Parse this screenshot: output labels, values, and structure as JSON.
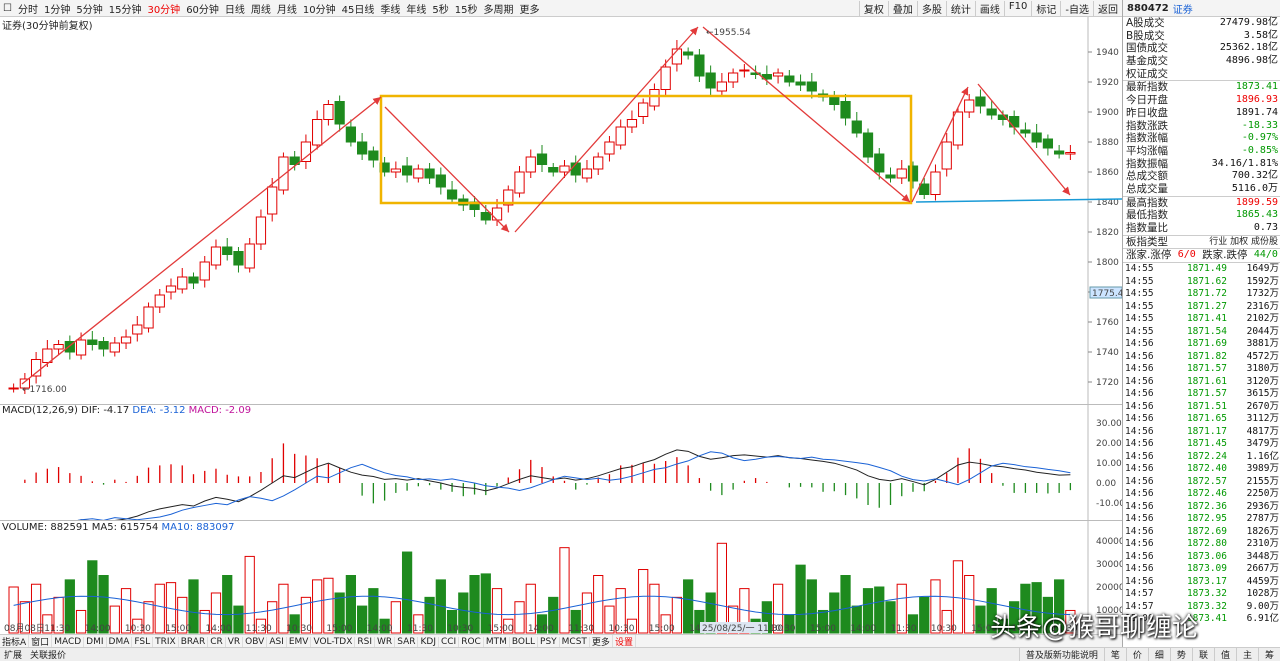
{
  "toolbar": {
    "items": [
      "分时",
      "1分钟",
      "5分钟",
      "15分钟",
      "30分钟",
      "60分钟",
      "日线",
      "周线",
      "月线",
      "10分钟",
      "45日线",
      "季线",
      "年线",
      "5秒",
      "15秒",
      "多周期",
      "更多"
    ],
    "active_index": 4,
    "right_items": [
      "复权",
      "叠加",
      "多股",
      "统计",
      "画线",
      "F10",
      "标记",
      "-自选",
      "返回"
    ]
  },
  "chart_title": "证券(30分钟前复权)",
  "price_chart": {
    "axis_ticks": [
      "1940",
      "1920",
      "1900",
      "1880",
      "1860",
      "1840",
      "1820",
      "1800",
      "1780",
      "1760",
      "1740",
      "1720"
    ],
    "current_price_tag": "1775.4",
    "high_label": "1955.54",
    "low_label": "1716.00",
    "date_labels": [
      "08月08日",
      "11:30",
      "14:00",
      "10:30",
      "15:00",
      "14:00",
      "11:30",
      "10:30",
      "15:00",
      "14:00",
      "11:30",
      "10:30",
      "15:00",
      "14:00",
      "11:30",
      "10:30",
      "15:00",
      "14:00",
      "11:30",
      "10:30",
      "15:00",
      "14:00",
      "11:30",
      "10:30",
      "15:00",
      "14:00",
      "11:30"
    ],
    "cursor_date": "25/08/25/一 11:30"
  },
  "macd": {
    "label": "MACD(12,26,9)",
    "dif": "DIF: -4.17",
    "dea": "DEA: -3.12",
    "macd": "MACD: -2.09",
    "axis_ticks": [
      "30.00",
      "20.00",
      "10.00",
      "0.00",
      "-10.00"
    ]
  },
  "volume": {
    "label": "VOLUME: 882591",
    "ma5": "MA5: 615754",
    "ma10": "MA10: 883097",
    "axis_ticks": [
      "40000",
      "30000",
      "20000",
      "10000"
    ]
  },
  "indicator_tabs": [
    "指标A",
    "窗口",
    "MACD",
    "DMI",
    "DMA",
    "FSL",
    "TRIX",
    "BRAR",
    "CR",
    "VR",
    "OBV",
    "ASI",
    "EMV",
    "VOL-TDX",
    "RSI",
    "WR",
    "SAR",
    "KDJ",
    "CCI",
    "ROC",
    "MTM",
    "BOLL",
    "PSY",
    "MCST",
    "更多",
    "设置"
  ],
  "right_panel": {
    "code": "880472",
    "name": "证券",
    "stats": [
      {
        "label": "A股成交",
        "value": "27479.98亿",
        "color": "blk"
      },
      {
        "label": "B股成交",
        "value": "3.58亿",
        "color": "blk"
      },
      {
        "label": "国债成交",
        "value": "25362.18亿",
        "color": "blk"
      },
      {
        "label": "基金成交",
        "value": "4896.98亿",
        "color": "blk"
      },
      {
        "label": "权证成交",
        "value": "",
        "color": "blk"
      },
      {
        "label": "最新指数",
        "value": "1873.41",
        "color": "green"
      },
      {
        "label": "今日开盘",
        "value": "1896.93",
        "color": "red"
      },
      {
        "label": "昨日收盘",
        "value": "1891.74",
        "color": "blk"
      },
      {
        "label": "指数涨跌",
        "value": "-18.33",
        "color": "green"
      },
      {
        "label": "指数涨幅",
        "value": "-0.97%",
        "color": "green"
      },
      {
        "label": "平均涨幅",
        "value": "-0.85%",
        "color": "green"
      },
      {
        "label": "指数振幅",
        "value": "34.16/1.81%",
        "color": "blk"
      },
      {
        "label": "总成交额",
        "value": "700.32亿",
        "color": "blk"
      },
      {
        "label": "总成交量",
        "value": "5116.0万",
        "color": "blk"
      },
      {
        "label": "最高指数",
        "value": "1899.59",
        "color": "red"
      },
      {
        "label": "最低指数",
        "value": "1865.43",
        "color": "green"
      },
      {
        "label": "指数量比",
        "value": "0.73",
        "color": "blk"
      }
    ],
    "sector_type": {
      "label": "板指类型",
      "value": "行业 加权 成份股"
    },
    "updown": {
      "label": "涨家.涨停",
      "v1": "6/0",
      "label2": "跌家.跌停",
      "v2": "44/0"
    },
    "ticks": [
      {
        "t": "14:55",
        "p": "1871.49",
        "v": "1649万"
      },
      {
        "t": "14:55",
        "p": "1871.62",
        "v": "1592万"
      },
      {
        "t": "14:55",
        "p": "1871.72",
        "v": "1732万"
      },
      {
        "t": "14:55",
        "p": "1871.27",
        "v": "2316万"
      },
      {
        "t": "14:55",
        "p": "1871.41",
        "v": "2102万"
      },
      {
        "t": "14:55",
        "p": "1871.54",
        "v": "2044万"
      },
      {
        "t": "14:56",
        "p": "1871.69",
        "v": "3881万"
      },
      {
        "t": "14:56",
        "p": "1871.82",
        "v": "4572万"
      },
      {
        "t": "14:56",
        "p": "1871.57",
        "v": "3180万"
      },
      {
        "t": "14:56",
        "p": "1871.61",
        "v": "3120万"
      },
      {
        "t": "14:56",
        "p": "1871.57",
        "v": "3615万"
      },
      {
        "t": "14:56",
        "p": "1871.51",
        "v": "2670万"
      },
      {
        "t": "14:56",
        "p": "1871.65",
        "v": "3112万"
      },
      {
        "t": "14:56",
        "p": "1871.17",
        "v": "4817万"
      },
      {
        "t": "14:56",
        "p": "1871.45",
        "v": "3479万"
      },
      {
        "t": "14:56",
        "p": "1872.24",
        "v": "1.16亿"
      },
      {
        "t": "14:56",
        "p": "1872.40",
        "v": "3989万"
      },
      {
        "t": "14:56",
        "p": "1872.57",
        "v": "2155万"
      },
      {
        "t": "14:56",
        "p": "1872.46",
        "v": "2250万"
      },
      {
        "t": "14:56",
        "p": "1872.36",
        "v": "2936万"
      },
      {
        "t": "14:56",
        "p": "1872.95",
        "v": "2787万"
      },
      {
        "t": "14:56",
        "p": "1872.69",
        "v": "1826万"
      },
      {
        "t": "14:56",
        "p": "1872.80",
        "v": "2310万"
      },
      {
        "t": "14:56",
        "p": "1873.06",
        "v": "3448万"
      },
      {
        "t": "14:56",
        "p": "1873.09",
        "v": "2667万"
      },
      {
        "t": "14:56",
        "p": "1873.17",
        "v": "4459万"
      },
      {
        "t": "14:57",
        "p": "1873.32",
        "v": "1028万"
      },
      {
        "t": "14:57",
        "p": "1873.32",
        "v": "9.00万"
      },
      {
        "t": "15:00",
        "p": "1873.41",
        "v": "6.91亿"
      }
    ]
  },
  "status": {
    "left": [
      "扩展",
      "关联报价"
    ],
    "right": [
      "普及版新功能说明",
      "笔",
      "价",
      "细",
      "势",
      "联",
      "值",
      "主",
      "筹"
    ]
  },
  "watermark": "头条@猴哥聊缠论",
  "colors": {
    "up": "#e00000",
    "down": "#1e8a1e",
    "box": "#f0b400",
    "arrow": "#e23a3a",
    "support": "#1a9ad6"
  }
}
